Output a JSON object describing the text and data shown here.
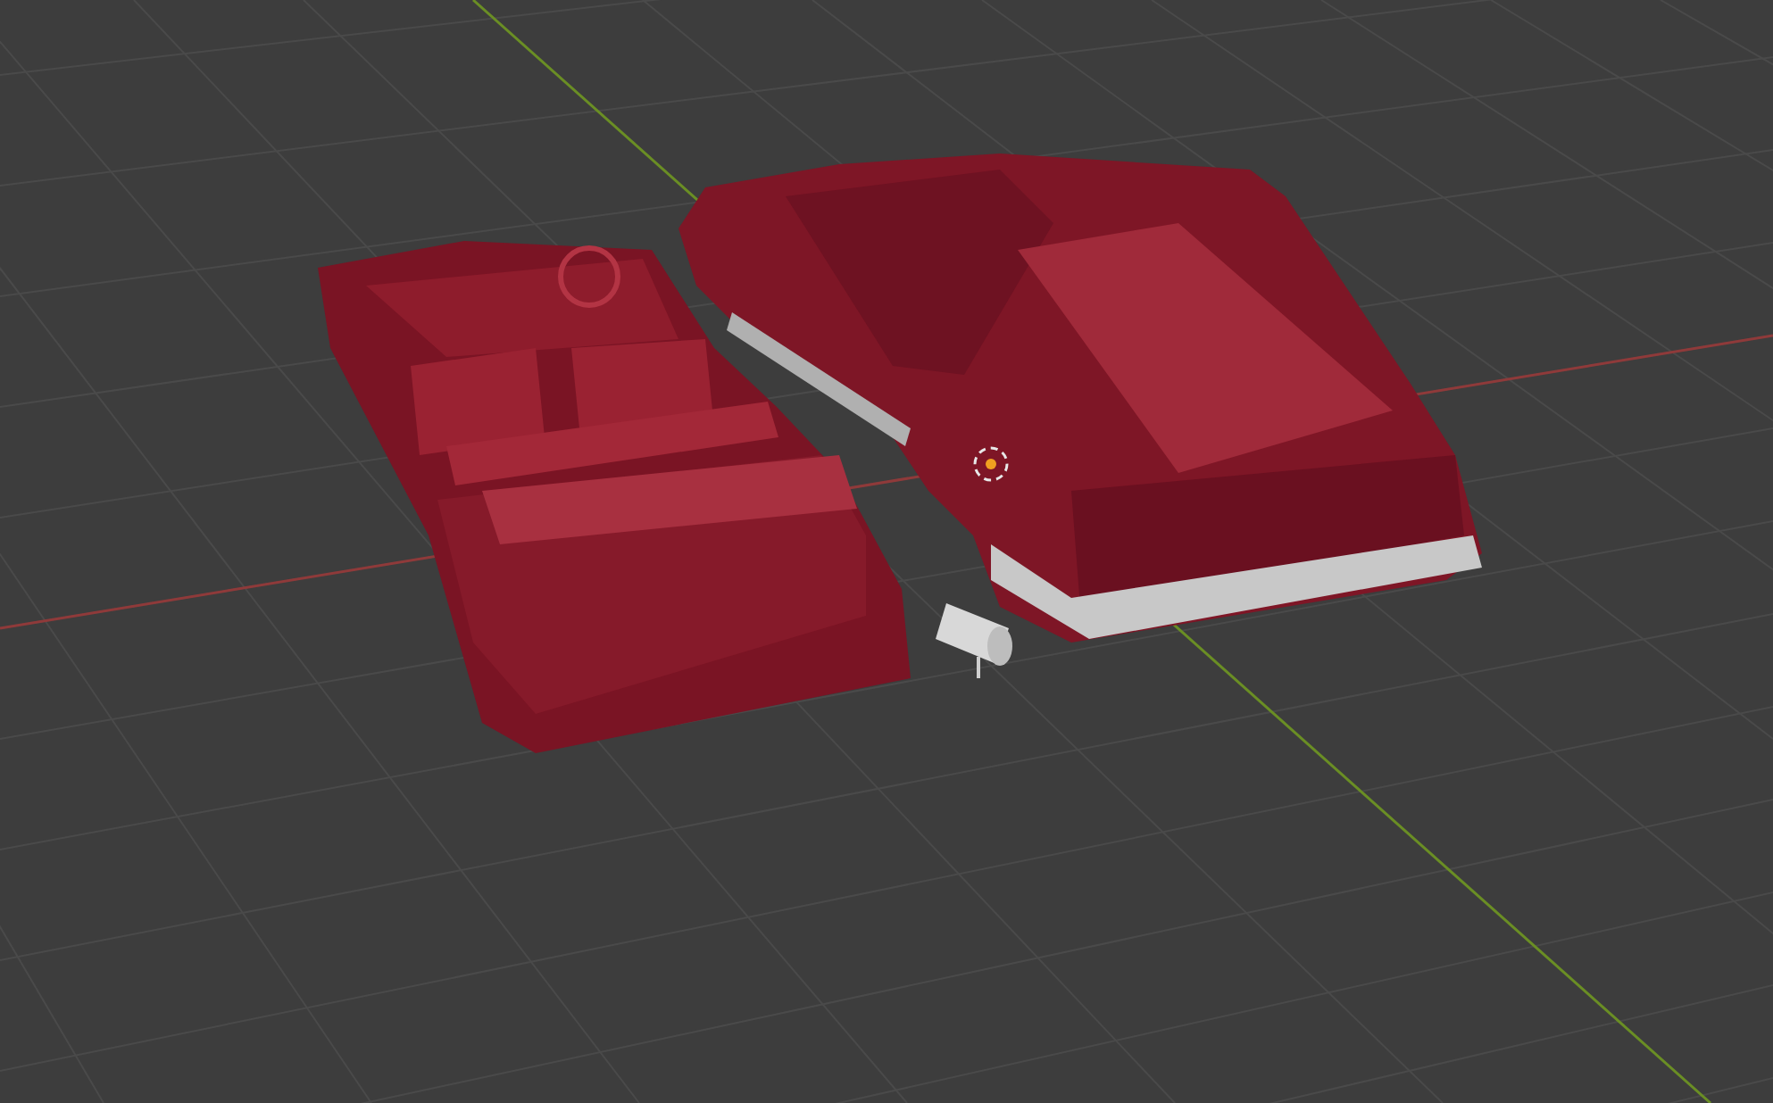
{
  "viewport": {
    "axes": [
      {
        "kind": "x",
        "color": "#8f3a3a"
      },
      {
        "kind": "y",
        "color": "#6a8e24"
      }
    ]
  }
}
